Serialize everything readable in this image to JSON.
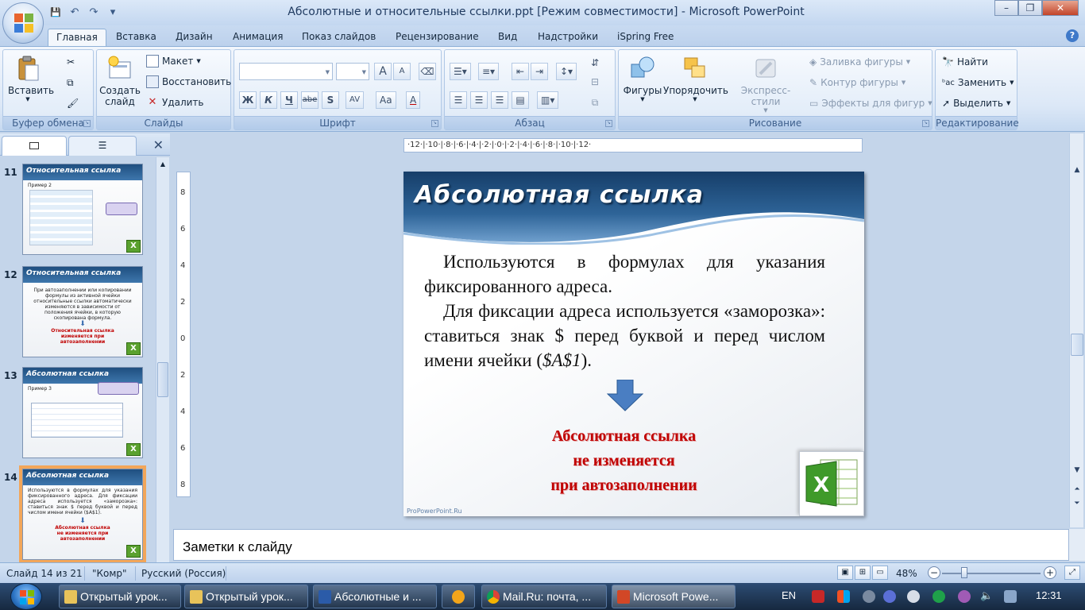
{
  "window": {
    "title": "Абсолютные и относительные ссылки.ppt [Режим совместимости] - Microsoft PowerPoint",
    "minimize": "–",
    "restore": "❐",
    "close": "✕"
  },
  "qat": {
    "save": "💾",
    "undo": "↶",
    "redo": "↷",
    "customize": "▾"
  },
  "tabs": [
    {
      "label": "Главная"
    },
    {
      "label": "Вставка"
    },
    {
      "label": "Дизайн"
    },
    {
      "label": "Анимация"
    },
    {
      "label": "Показ слайдов"
    },
    {
      "label": "Рецензирование"
    },
    {
      "label": "Вид"
    },
    {
      "label": "Надстройки"
    },
    {
      "label": "iSpring Free"
    }
  ],
  "ribbon": {
    "clipboard": {
      "label": "Буфер обмена",
      "paste": "Вставить"
    },
    "slides": {
      "label": "Слайды",
      "new_slide_1": "Создать",
      "new_slide_2": "слайд",
      "layout": "Макет",
      "reset": "Восстановить",
      "delete": "Удалить"
    },
    "font": {
      "label": "Шрифт",
      "bold": "Ж",
      "italic": "К",
      "underline": "Ч",
      "strike": "abe",
      "shadow": "S",
      "spacing": "AV",
      "case": "Aa",
      "color": "A",
      "grow": "A",
      "shrink": "A"
    },
    "paragraph": {
      "label": "Абзац"
    },
    "drawing": {
      "label": "Рисование",
      "shapes": "Фигуры",
      "arrange": "Упорядочить",
      "quick_styles": "Экспресс-стили",
      "shape_fill": "Заливка фигуры",
      "shape_outline": "Контур фигуры",
      "shape_effects": "Эффекты для фигур"
    },
    "editing": {
      "label": "Редактирование",
      "find": "Найти",
      "replace": "Заменить",
      "select": "Выделить"
    }
  },
  "left_panel": {
    "close": "✕",
    "thumbnails": [
      {
        "num": "11",
        "title": "Относительная ссылка",
        "body": "Пример 2",
        "red": ""
      },
      {
        "num": "12",
        "title": "Относительная ссылка",
        "body": "При автозаполнении или копировании формулы из активной ячейки относительные ссылки автоматически изменяются в зависимости от положения ячейки, в которую скопирована формула.",
        "red": "Относительная ссылка изменяется при автозаполнении"
      },
      {
        "num": "13",
        "title": "Абсолютная ссылка",
        "body": "Пример 3",
        "red": ""
      },
      {
        "num": "14",
        "title": "Абсолютная ссылка",
        "body": "Используются в формулах для указания фиксированного адреса. Для фиксации адреса используется «заморозка»: ставиться знак $ перед буквой и перед числом имени ячейки ($A$1).",
        "red": "Абсолютная ссылка не изменяется при автозаполнении"
      }
    ]
  },
  "slide": {
    "title": "Абсолютная  ссылка",
    "para1": "Используются в формулах для указания фиксированного адреса.",
    "para2_a": "Для фиксации адреса используется «заморозка»: ставиться знак $ перед буквой и перед числом имени ячейки (",
    "para2_ref": "$A$1",
    "para2_b": ").",
    "red_1": "Абсолютная ссылка",
    "red_2": "не изменяется",
    "red_3": "при автозаполнении",
    "footer": "ProPowerPoint.Ru"
  },
  "ruler": {
    "horizontal": "·12·|·10·|·8·|·6·|·4·|·2·|·0·|·2·|·4·|·6·|·8·|·10·|·12·",
    "vertical": [
      "8",
      "6",
      "4",
      "2",
      "0",
      "2",
      "4",
      "6",
      "8"
    ]
  },
  "notes": {
    "placeholder": "Заметки к слайду"
  },
  "status": {
    "slide": "Слайд 14 из 21",
    "theme": "\"Комр\"",
    "language": "Русский (Россия)",
    "zoom": "48%",
    "zoom_fraction": 0.48
  },
  "taskbar": {
    "items": [
      {
        "label": "Открытый урок..."
      },
      {
        "label": "Открытый урок..."
      },
      {
        "label": "Абсолютные и ..."
      },
      {
        "label": "Mail.Ru: почта, ..."
      },
      {
        "label": "Microsoft Powe..."
      }
    ],
    "lang": "EN",
    "clock": "12:31"
  },
  "colors": {
    "accent": "#2b579a",
    "slide_title_bg": "#1f4f80",
    "red_text": "#c00000"
  }
}
